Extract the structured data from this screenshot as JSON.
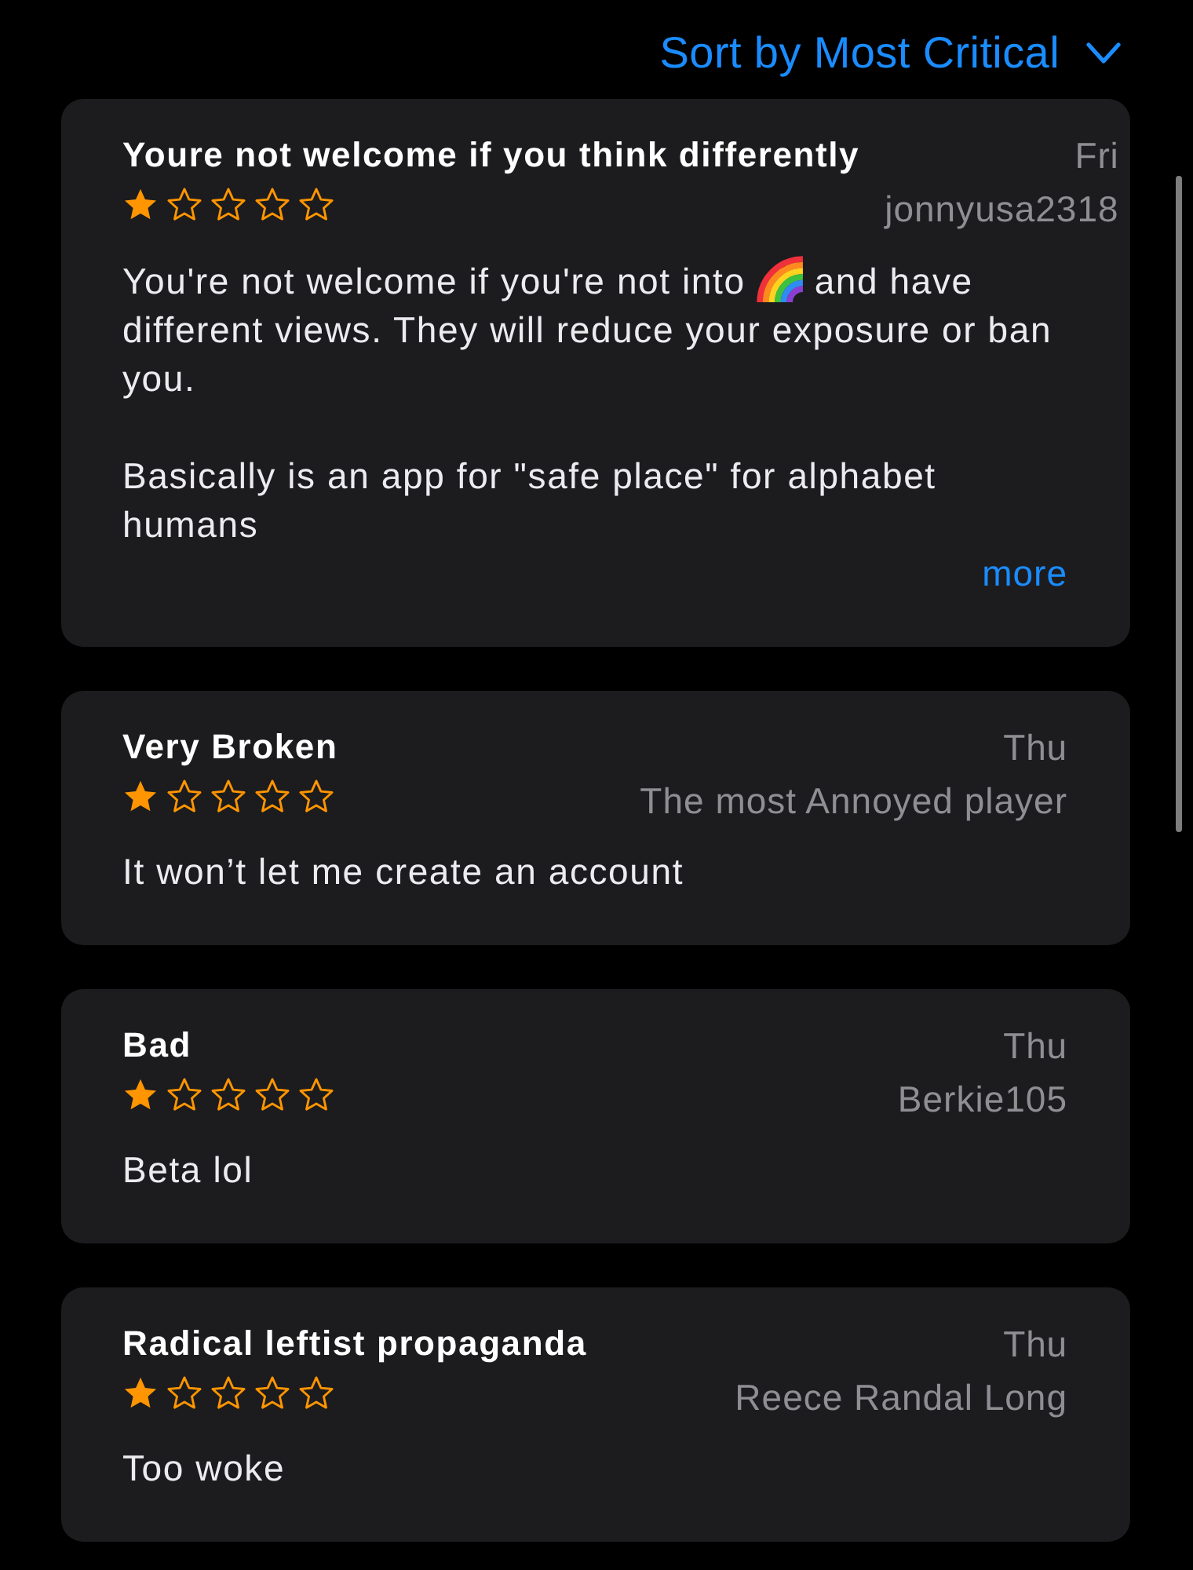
{
  "sort_menu": {
    "label": "Sort by Most Critical"
  },
  "reviews": [
    {
      "title": "Youre not welcome if you think differently",
      "date": "Fri",
      "author": "jonnyusa2318",
      "stars": 1,
      "body": [
        [
          {
            "kind": "text",
            "text": "You're not welcome if you're not into"
          },
          {
            "kind": "rainbow"
          },
          {
            "kind": "text",
            "text": "and have different views. They will reduce your exposure or ban you."
          }
        ],
        [
          {
            "kind": "text",
            "text": "Basically is an app for \"safe place\" for alphabet humans"
          }
        ]
      ],
      "more": "more"
    },
    {
      "title": "Very Broken",
      "date": "Thu",
      "author": "The most Annoyed player",
      "stars": 1,
      "body": [
        [
          {
            "kind": "text",
            "text": "It won’t let me create an account"
          }
        ]
      ]
    },
    {
      "title": "Bad",
      "date": "Thu",
      "author": "Berkie105",
      "stars": 1,
      "body": [
        [
          {
            "kind": "text",
            "text": "Beta lol"
          }
        ]
      ]
    },
    {
      "title": "Radical leftist propaganda",
      "date": "Thu",
      "author": "Reece Randal Long",
      "stars": 1,
      "body": [
        [
          {
            "kind": "text",
            "text": "Too woke"
          }
        ]
      ]
    }
  ]
}
